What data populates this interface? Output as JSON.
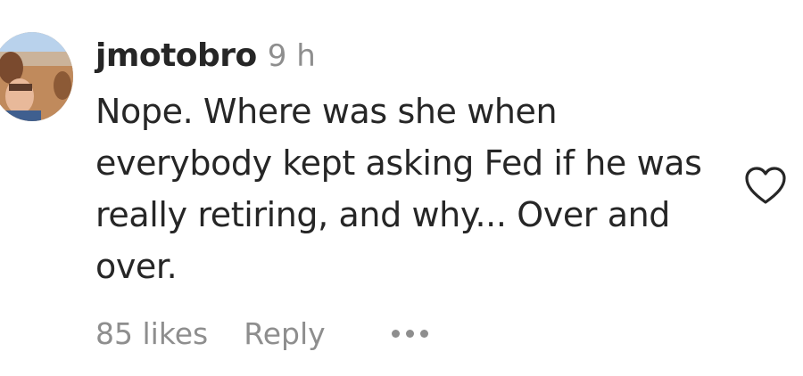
{
  "comment": {
    "username": "jmotobro",
    "time": "9 h",
    "text": "Nope. Where was she when everybody kept asking Fed if he was really retiring, and why... Over and over.",
    "likes": "85 likes",
    "reply_label": "Reply",
    "more_icon": "more-options-icon",
    "like_icon": "heart-icon"
  },
  "colors": {
    "primary_text": "#262626",
    "secondary_text": "#8e8e8e"
  }
}
